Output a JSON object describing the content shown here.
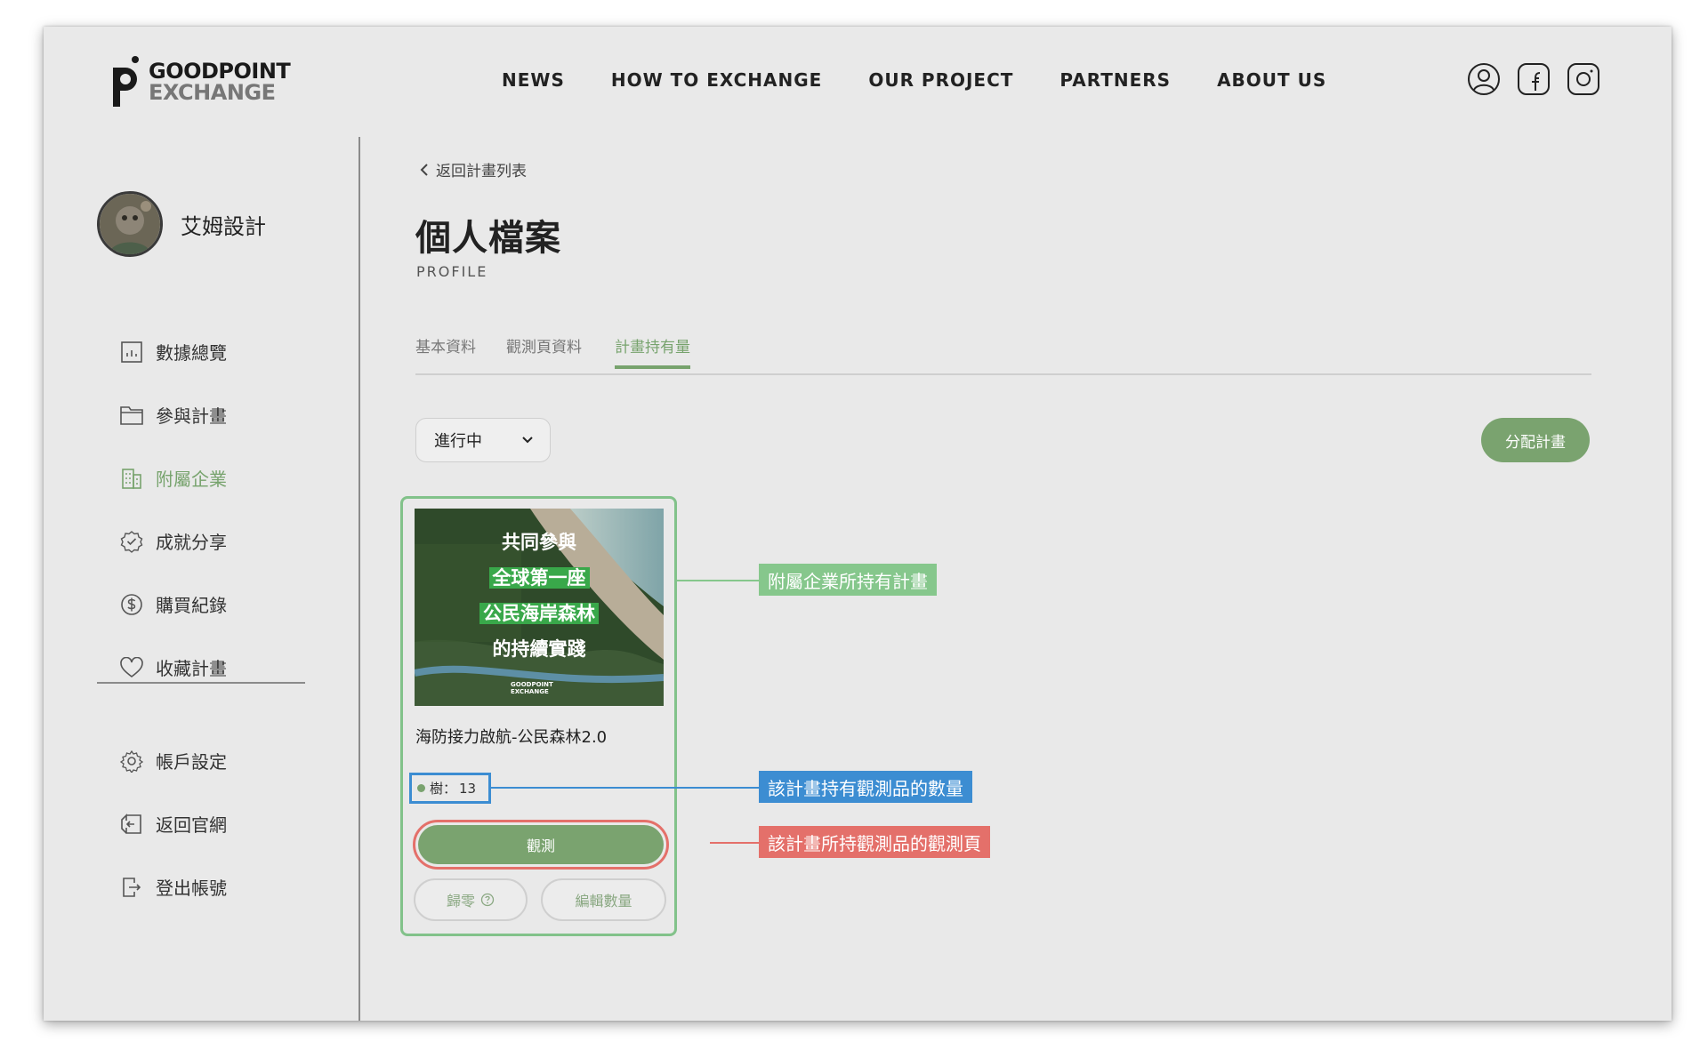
{
  "brand": {
    "line1": "GOODPOINT",
    "line2": "EXCHANGE"
  },
  "nav": [
    "NEWS",
    "HOW TO EXCHANGE",
    "OUR PROJECT",
    "PARTNERS",
    "ABOUT US"
  ],
  "header_icons": [
    "user-icon",
    "facebook-icon",
    "instagram-icon"
  ],
  "profile": {
    "name": "艾姆設計"
  },
  "sidebar": {
    "items": [
      {
        "label": "數據總覽",
        "icon": "chart-icon"
      },
      {
        "label": "參與計畫",
        "icon": "folder-icon"
      },
      {
        "label": "附屬企業",
        "icon": "building-icon",
        "active": true
      },
      {
        "label": "成就分享",
        "icon": "badge-check-icon"
      },
      {
        "label": "購買紀錄",
        "icon": "dollar-icon"
      },
      {
        "label": "收藏計畫",
        "icon": "heart-icon"
      }
    ],
    "items2": [
      {
        "label": "帳戶設定",
        "icon": "gear-icon"
      },
      {
        "label": "返回官網",
        "icon": "home-return-icon"
      },
      {
        "label": "登出帳號",
        "icon": "logout-icon"
      }
    ]
  },
  "main": {
    "back_label": "返回計畫列表",
    "title": "個人檔案",
    "subtitle": "PROFILE",
    "tabs": [
      "基本資料",
      "觀測頁資料",
      "計畫持有量"
    ],
    "active_tab": 2,
    "status_select": "進行中",
    "assign_button": "分配計畫"
  },
  "card": {
    "image_lines": [
      "共同參與",
      "全球第一座",
      "公民海岸森林",
      "的持續實踐"
    ],
    "image_logo": "GOODPOINT EXCHANGE",
    "title": "海防接力啟航-公民森林2.0",
    "qty_label": "樹：",
    "qty_value": "13",
    "observe_button": "觀測",
    "zero_button": "歸零",
    "edit_button": "編輯數量"
  },
  "annotations": {
    "card": "附屬企業所持有計畫",
    "qty": "該計畫持有觀測品的數量",
    "observe": "該計畫所持觀測品的觀測頁"
  },
  "colors": {
    "accent_green": "#7aa36f",
    "card_border": "#82c28a",
    "ann_green": "#86c78c",
    "ann_blue": "#3c8dd2",
    "ann_red": "#e4706a"
  }
}
